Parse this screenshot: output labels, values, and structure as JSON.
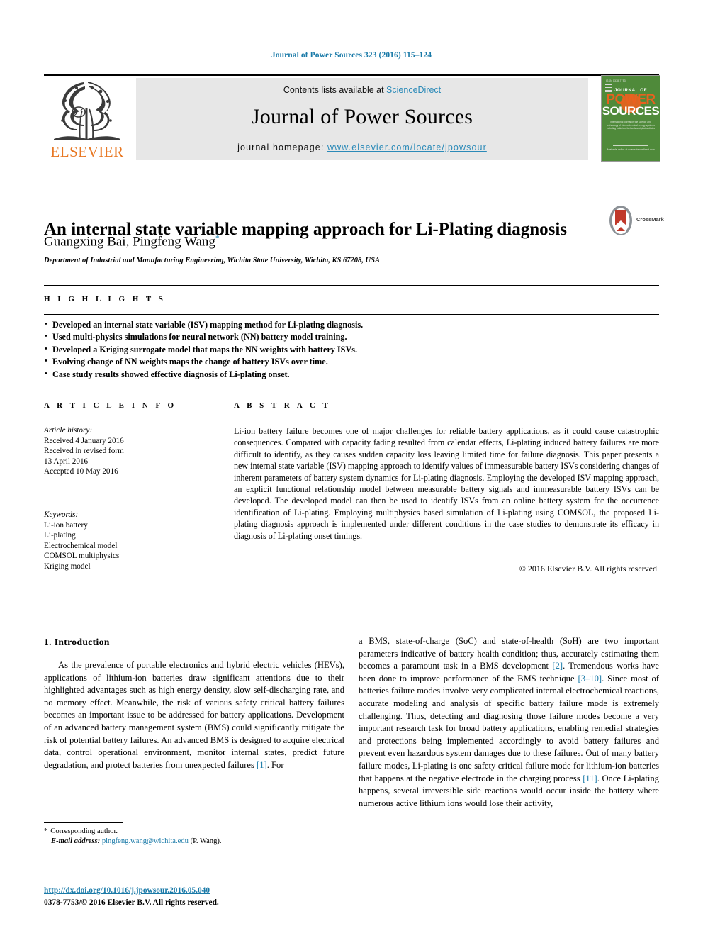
{
  "running_head": "Journal of Power Sources 323 (2016) 115–124",
  "masthead": {
    "contents_prefix": "Contents lists available at ",
    "sciencedirect": "ScienceDirect",
    "journal_name": "Journal of Power Sources",
    "homepage_prefix": "journal homepage: ",
    "homepage_url": "www.elsevier.com/locate/jpowsour",
    "publisher_wordmark": "ELSEVIER",
    "cover": {
      "top_tiny": "ISSN 0378-7753",
      "journal_of": "JOURNAL OF",
      "power": "POWER",
      "sources": "SOURCES",
      "blurb": "International journal on the science and technology of electrochemical energy systems including batteries, fuel cells and photovoltaics",
      "bottom": "Available online at www.sciencedirect.com"
    },
    "colors": {
      "link_blue": "#2b8ab8",
      "elsevier_orange": "#e87722",
      "cover_green": "#4f8a3a",
      "panel_gray": "#e7e7e7"
    }
  },
  "article": {
    "title": "An internal state variable mapping approach for Li-Plating diagnosis",
    "authors": "Guangxing Bai, Pingfeng Wang",
    "author_marker": "*",
    "affiliation": "Department of Industrial and Manufacturing Engineering, Wichita State University, Wichita, KS 67208, USA",
    "crossmark_label": "CrossMark"
  },
  "highlights": {
    "header": "H I G H L I G H T S",
    "items": [
      "Developed an internal state variable (ISV) mapping method for Li-plating diagnosis.",
      "Used multi-physics simulations for neural network (NN) battery model training.",
      "Developed a Kriging surrogate model that maps the NN weights with battery ISVs.",
      "Evolving change of NN weights maps the change of battery ISVs over time.",
      "Case study results showed effective diagnosis of Li-plating onset."
    ]
  },
  "article_info": {
    "header": "A R T I C L E   I N F O",
    "history_label": "Article history:",
    "history": [
      "Received 4 January 2016",
      "Received in revised form",
      "13 April 2016",
      "Accepted 10 May 2016"
    ],
    "keywords_label": "Keywords:",
    "keywords": [
      "Li-ion battery",
      "Li-plating",
      "Electrochemical model",
      "COMSOL multiphysics",
      "Kriging model"
    ]
  },
  "abstract": {
    "header": "A B S T R A C T",
    "text": "Li-ion battery failure becomes one of major challenges for reliable battery applications, as it could cause catastrophic consequences. Compared with capacity fading resulted from calendar effects, Li-plating induced battery failures are more difficult to identify, as they causes sudden capacity loss leaving limited time for failure diagnosis. This paper presents a new internal state variable (ISV) mapping approach to identify values of immeasurable battery ISVs considering changes of inherent parameters of battery system dynamics for Li-plating diagnosis. Employing the developed ISV mapping approach, an explicit functional relationship model between measurable battery signals and immeasurable battery ISVs can be developed. The developed model can then be used to identify ISVs from an online battery system for the occurrence identification of Li-plating. Employing multiphysics based simulation of Li-plating using COMSOL, the proposed Li-plating diagnosis approach is implemented under different conditions in the case studies to demonstrate its efficacy in diagnosis of Li-plating onset timings.",
    "copyright": "© 2016 Elsevier B.V. All rights reserved."
  },
  "body": {
    "section_title": "1.  Introduction",
    "left_p1_a": "As the prevalence of portable electronics and hybrid electric vehicles (HEVs), applications of lithium-ion batteries draw significant attentions due to their highlighted advantages such as high energy density, slow self-discharging rate, and no memory effect. Meanwhile, the risk of various safety critical battery failures becomes an important issue to be addressed for battery applications. Development of an advanced battery management system (BMS) could significantly mitigate the risk of potential battery failures. An advanced BMS is designed to acquire electrical data, control operational environment, monitor internal states, predict future degradation, and protect batteries from unexpected failures ",
    "left_ref1": "[1]",
    "left_p1_b": ". For",
    "right_a": "a BMS, state-of-charge (SoC) and state-of-health (SoH) are two important parameters indicative of battery health condition; thus, accurately estimating them becomes a paramount task in a BMS development ",
    "right_ref2": "[2]",
    "right_b": ". Tremendous works have been done to improve performance of the BMS technique ",
    "right_ref3": "[3–10]",
    "right_c": ". Since most of batteries failure modes involve very complicated internal electrochemical reactions, accurate modeling and analysis of specific battery failure mode is extremely challenging. Thus, detecting and diagnosing those failure modes become a very important research task for broad battery applications, enabling remedial strategies and protections being implemented accordingly to avoid battery failures and prevent even hazardous system damages due to these failures. Out of many battery failure modes, Li-plating is one safety critical failure mode for lithium-ion batteries that happens at the negative electrode in the charging process ",
    "right_ref4": "[11]",
    "right_d": ". Once Li-plating happens, several irreversible side reactions would occur inside the battery where numerous active lithium ions would lose their activity,"
  },
  "footer": {
    "corresponding_star": "*",
    "corresponding_label": "Corresponding author.",
    "email_label": "E-mail address:",
    "email": "pingfeng.wang@wichita.edu",
    "email_suffix": " (P. Wang).",
    "doi": "http://dx.doi.org/10.1016/j.jpowsour.2016.05.040",
    "issn": "0378-7753/© 2016 Elsevier B.V. All rights reserved."
  }
}
